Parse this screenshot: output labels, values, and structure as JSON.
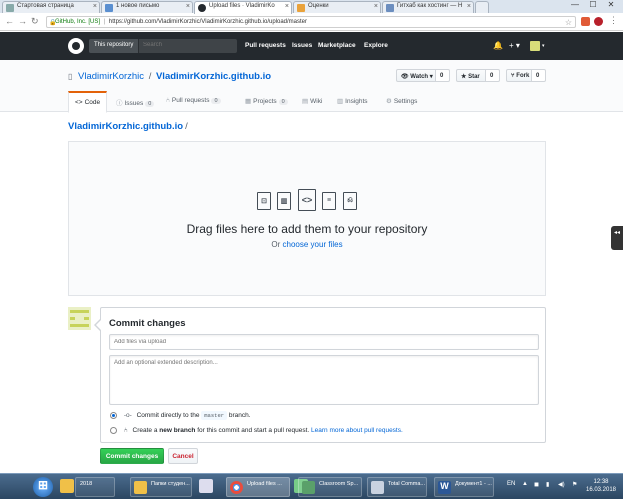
{
  "browser": {
    "tabs": [
      {
        "label": "Стартовая страница",
        "active": false
      },
      {
        "label": "1 новое письмо",
        "active": false
      },
      {
        "label": "Upload files · VladimirKo",
        "active": true
      },
      {
        "label": "Оценки",
        "active": false
      },
      {
        "label": "Гитхаб как хостинг — Н",
        "active": false
      }
    ],
    "url_site": "GitHub, Inc. [US]",
    "url": "https://github.com/VladimirKorzhic/VladimirKorzhic.github.io/upload/master",
    "window_controls": {
      "minimize": "—",
      "maximize": "☐",
      "close": "✕"
    }
  },
  "github_header": {
    "scope_label": "This repository",
    "search_placeholder": "Search",
    "nav": [
      "Pull requests",
      "Issues",
      "Marketplace",
      "Explore"
    ],
    "bell": "🔔",
    "plus": "+ ▾",
    "avatar_caret": "▾"
  },
  "repo": {
    "owner": "VladimirKorzhic",
    "name": "VladimirKorzhic.github.io",
    "watch": {
      "label": "Watch ▾",
      "count": "0"
    },
    "star": {
      "label": "Star",
      "count": "0"
    },
    "fork": {
      "label": "Fork",
      "count": "0"
    },
    "tabs": [
      {
        "label": "Code",
        "icon": "<>",
        "count": null
      },
      {
        "label": "Issues",
        "icon": "ⓘ",
        "count": "0"
      },
      {
        "label": "Pull requests",
        "icon": "⑃",
        "count": "0"
      },
      {
        "label": "Projects",
        "icon": "▦",
        "count": "0"
      },
      {
        "label": "Wiki",
        "icon": "▤",
        "count": null
      },
      {
        "label": "Insights",
        "icon": "▥",
        "count": null
      },
      {
        "label": "Settings",
        "icon": "⚙",
        "count": null
      }
    ]
  },
  "breadcrumb": {
    "repo": "VladimirKorzhic.github.io",
    "sep": "/"
  },
  "dropzone": {
    "title": "Drag files here to add them to your repository",
    "or_text": "Or ",
    "choose_link": "choose your files"
  },
  "commit": {
    "title": "Commit changes",
    "summary_placeholder": "Add files via upload",
    "description_placeholder": "Add an optional extended description...",
    "option_direct_pre": "Commit directly to the ",
    "branch": "master",
    "option_direct_post": " branch.",
    "option_new_pre": "Create a ",
    "option_new_bold": "new branch",
    "option_new_mid": " for this commit and start a pull request. ",
    "option_new_link": "Learn more about pull requests.",
    "submit_label": "Commit changes",
    "cancel_label": "Cancel"
  },
  "taskbar": {
    "items": [
      {
        "label": "2018"
      },
      {
        "label": "Папки студен..."
      },
      {
        "label": "Upload files ..."
      },
      {
        "label": "Classroom Sp..."
      },
      {
        "label": "Total Comma..."
      },
      {
        "label": "Документ1 - ..."
      }
    ],
    "lang": "EN",
    "time": "12:38",
    "date": "16.03.2018"
  },
  "colors": {
    "header_bg": "#24292e",
    "link": "#0366d6",
    "primary_btn": "#28a745",
    "cancel_text": "#cb2431",
    "selected_tab_border": "#e36209"
  }
}
